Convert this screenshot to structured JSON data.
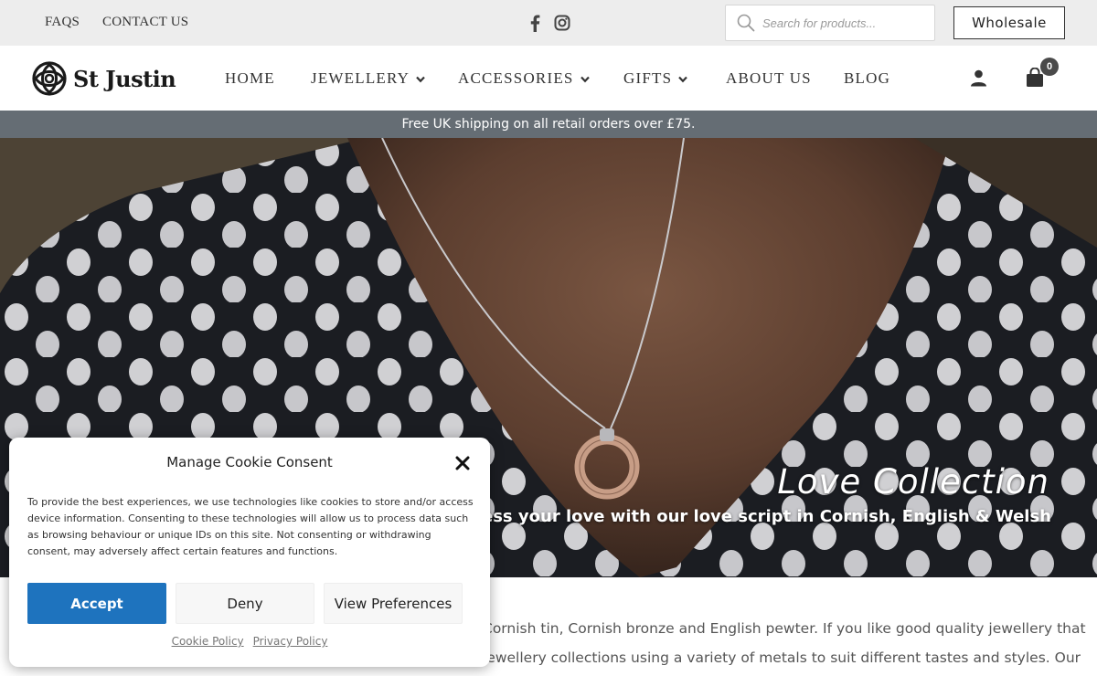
{
  "topbar": {
    "links": [
      {
        "label": "FAQS"
      },
      {
        "label": "CONTACT US"
      }
    ],
    "social": [
      "facebook-icon",
      "instagram-icon"
    ],
    "search": {
      "placeholder": "Search for products..."
    },
    "wholesale_label": "Wholesale"
  },
  "header": {
    "logo_text": "St Justin",
    "nav": [
      {
        "label": "HOME",
        "has_dropdown": false
      },
      {
        "label": "JEWELLERY",
        "has_dropdown": true
      },
      {
        "label": "ACCESSORIES",
        "has_dropdown": true
      },
      {
        "label": "GIFTS",
        "has_dropdown": true
      },
      {
        "label": "ABOUT US",
        "has_dropdown": false
      },
      {
        "label": "BLOG",
        "has_dropdown": false
      }
    ],
    "cart_count": "0"
  },
  "shipping_banner": "Free UK shipping on all retail orders over £75.",
  "hero": {
    "title": "Love Collection",
    "subtitle": "Express your love with our love script in Cornish, English & Welsh"
  },
  "intro": {
    "line1": "Cornish tin, Cornish bronze and English pewter. If you like good quality jewellery that",
    "line2": "jewellery collections using a variety of metals to suit different tastes and styles. Our"
  },
  "cookie": {
    "title": "Manage Cookie Consent",
    "body": "To provide the best experiences, we use technologies like cookies to store and/or access device information. Consenting to these technologies will allow us to process data such as browsing behaviour or unique IDs on this site. Not consenting or withdrawing consent, may adversely affect certain features and functions.",
    "accept_label": "Accept",
    "deny_label": "Deny",
    "prefs_label": "View Preferences",
    "cookie_policy": "Cookie Policy",
    "privacy_policy": "Privacy Policy"
  },
  "colors": {
    "accent": "#1e73be",
    "banner": "#656d74",
    "topbar": "#ededed"
  }
}
